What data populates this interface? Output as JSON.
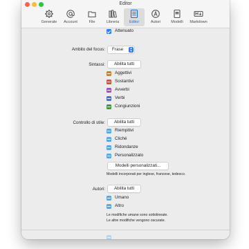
{
  "window": {
    "title": "Editor"
  },
  "toolbar": {
    "items": [
      {
        "label": "Generale",
        "icon": "gear-icon"
      },
      {
        "label": "Account",
        "icon": "at-icon"
      },
      {
        "label": "File",
        "icon": "folder-icon"
      },
      {
        "label": "Libreria",
        "icon": "library-icon"
      },
      {
        "label": "Editor",
        "icon": "editor-icon",
        "selected": true
      },
      {
        "label": "Autori",
        "icon": "authors-icon"
      },
      {
        "label": "Modelli",
        "icon": "templates-icon"
      },
      {
        "label": "Markdown",
        "icon": "markdown-icon"
      }
    ]
  },
  "top_option": {
    "label": "Attenuato",
    "checked": true
  },
  "focus": {
    "label": "Ambito del focus:",
    "value": "Frase"
  },
  "syntax": {
    "label": "Sintassi:",
    "enable_all": "Abilita tutti",
    "items": [
      {
        "label": "Aggettivi",
        "color": "#c8842a"
      },
      {
        "label": "Sostantivi",
        "color": "#d9503b"
      },
      {
        "label": "Avverbi",
        "color": "#a24fc3"
      },
      {
        "label": "Verbi",
        "color": "#4a6fd1"
      },
      {
        "label": "Congiunzioni",
        "color": "#3f9a3f"
      }
    ]
  },
  "style": {
    "label": "Controllo di stile:",
    "enable_all": "Abilita tutti",
    "items": [
      {
        "label": "Riempitivi"
      },
      {
        "label": "Cliché"
      },
      {
        "label": "Ridondanze"
      },
      {
        "label": "Personalizzato"
      }
    ],
    "custom_button": "Modelli personalizzati...",
    "note": "Modelli incorporati per inglese, francese, tedesco."
  },
  "authors": {
    "label": "Autori:",
    "enable_all": "Abilita tutti",
    "items": [
      {
        "label": "Umano"
      },
      {
        "label": "Altro"
      }
    ],
    "note_1": "Le modifiche umane sono sottolineate.",
    "note_2": "Le altre modifiche vengono oscurate."
  },
  "colors": {
    "accent": "#2f7bf5",
    "style_toggle": "#5aa8ea"
  }
}
